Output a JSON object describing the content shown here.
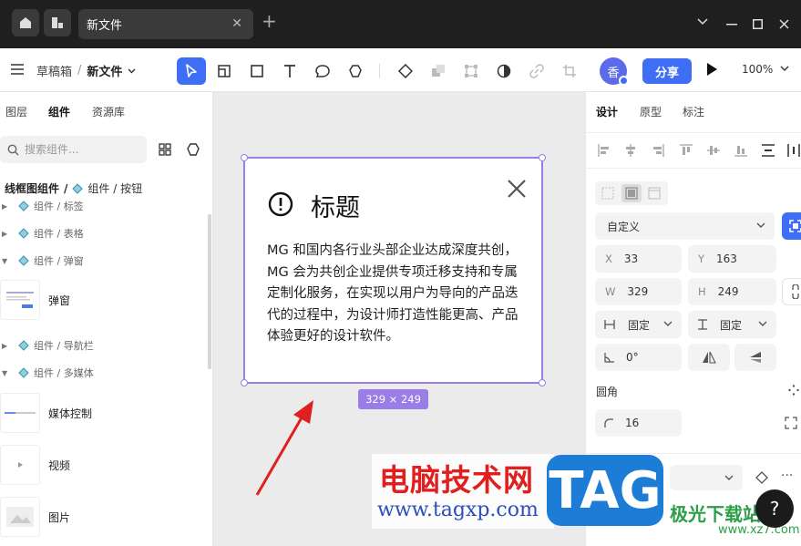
{
  "titlebar": {
    "tab_title": "新文件",
    "tab_close": "✕",
    "new_tab": "+"
  },
  "toolbar": {
    "breadcrumb_root": "草稿箱",
    "breadcrumb_sep": "/",
    "breadcrumb_doc": "新文件",
    "avatar_initial": "香",
    "share_label": "分享",
    "zoom_value": "100%"
  },
  "left_panel": {
    "tabs": [
      "图层",
      "组件",
      "资源库"
    ],
    "active_tab": "组件",
    "search_placeholder": "搜索组件...",
    "lib_root": "线框图组件",
    "lib_sep": "/",
    "lib_current": "组件 / 按钮",
    "tree": [
      {
        "label": "组件 / 标签",
        "expanded": false
      },
      {
        "label": "组件 / 表格",
        "expanded": false
      },
      {
        "label": "组件 / 弹窗",
        "expanded": true
      },
      {
        "label": "组件 / 导航栏",
        "expanded": false
      },
      {
        "label": "组件 / 多媒体",
        "expanded": true
      }
    ],
    "components": [
      "弹窗",
      "媒体控制",
      "视频",
      "图片"
    ]
  },
  "canvas": {
    "dialog_title": "标题",
    "dialog_body": "MG 和国内各行业头部企业达成深度共创，MG 会为共创企业提供专项迁移支持和专属定制化服务，在实现以用户为导向的产品迭代的过程中，为设计师打造性能更高、产品体验更好的设计软件。",
    "size_badge": "329 × 249"
  },
  "right_panel": {
    "tabs": [
      "设计",
      "原型",
      "标注"
    ],
    "active_tab": "设计",
    "frame_preset": "自定义",
    "x_label": "X",
    "x_value": "33",
    "y_label": "Y",
    "y_value": "163",
    "w_label": "W",
    "w_value": "329",
    "h_label": "H",
    "h_value": "249",
    "w_mode": "固定",
    "h_mode": "固定",
    "rotation": "0°",
    "radius_title": "圆角",
    "radius_value": "16"
  },
  "watermark": {
    "cn": "电脑技术网",
    "url": "www.tagxp.com",
    "tag": "TAG",
    "brand": "极光下载站",
    "site": "www.xz7.com"
  },
  "help": "?",
  "colors": {
    "accent": "#3f6ef6",
    "selection": "#9a7de6",
    "titlebar": "#1f1f1f"
  }
}
